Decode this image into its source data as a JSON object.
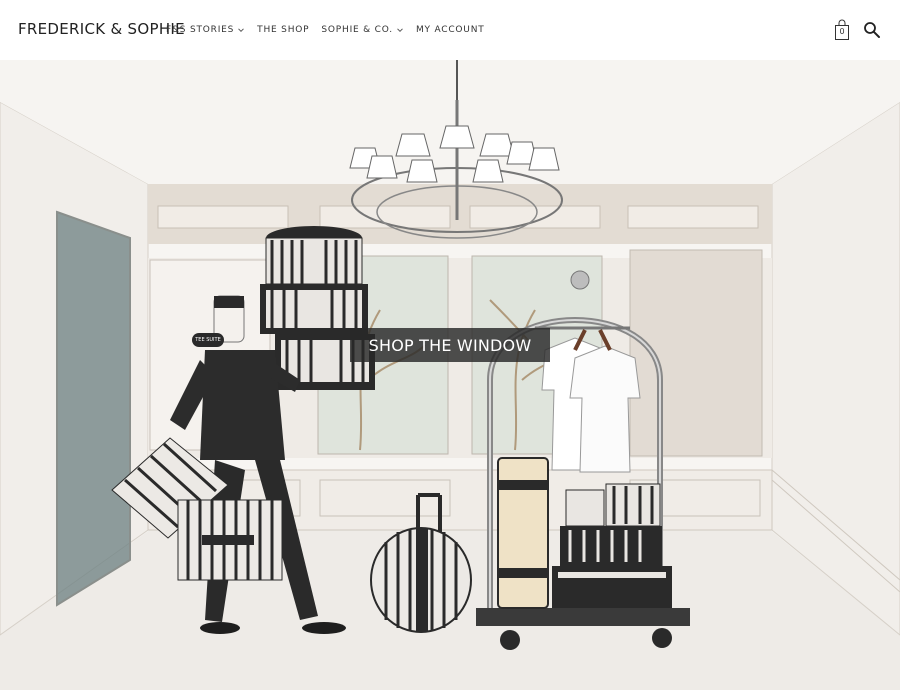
{
  "header": {
    "brand": "FREDERICK & SOPHIE",
    "nav": [
      {
        "label": "F&S STORIES",
        "has_dropdown": true
      },
      {
        "label": "THE SHOP",
        "has_dropdown": false
      },
      {
        "label": "SOPHIE & CO.",
        "has_dropdown": true
      },
      {
        "label": "MY ACCOUNT",
        "has_dropdown": false
      }
    ],
    "cart_count": "0",
    "icons": {
      "cart": "shopping-bag-icon",
      "search": "search-icon"
    }
  },
  "hero": {
    "cta_label": "SHOP THE WINDOW",
    "tag_label": "TEE SUITE",
    "colors": {
      "background": "#f3f1ee",
      "cta": "#282828",
      "wall_panel": "#d9d2c9"
    }
  }
}
